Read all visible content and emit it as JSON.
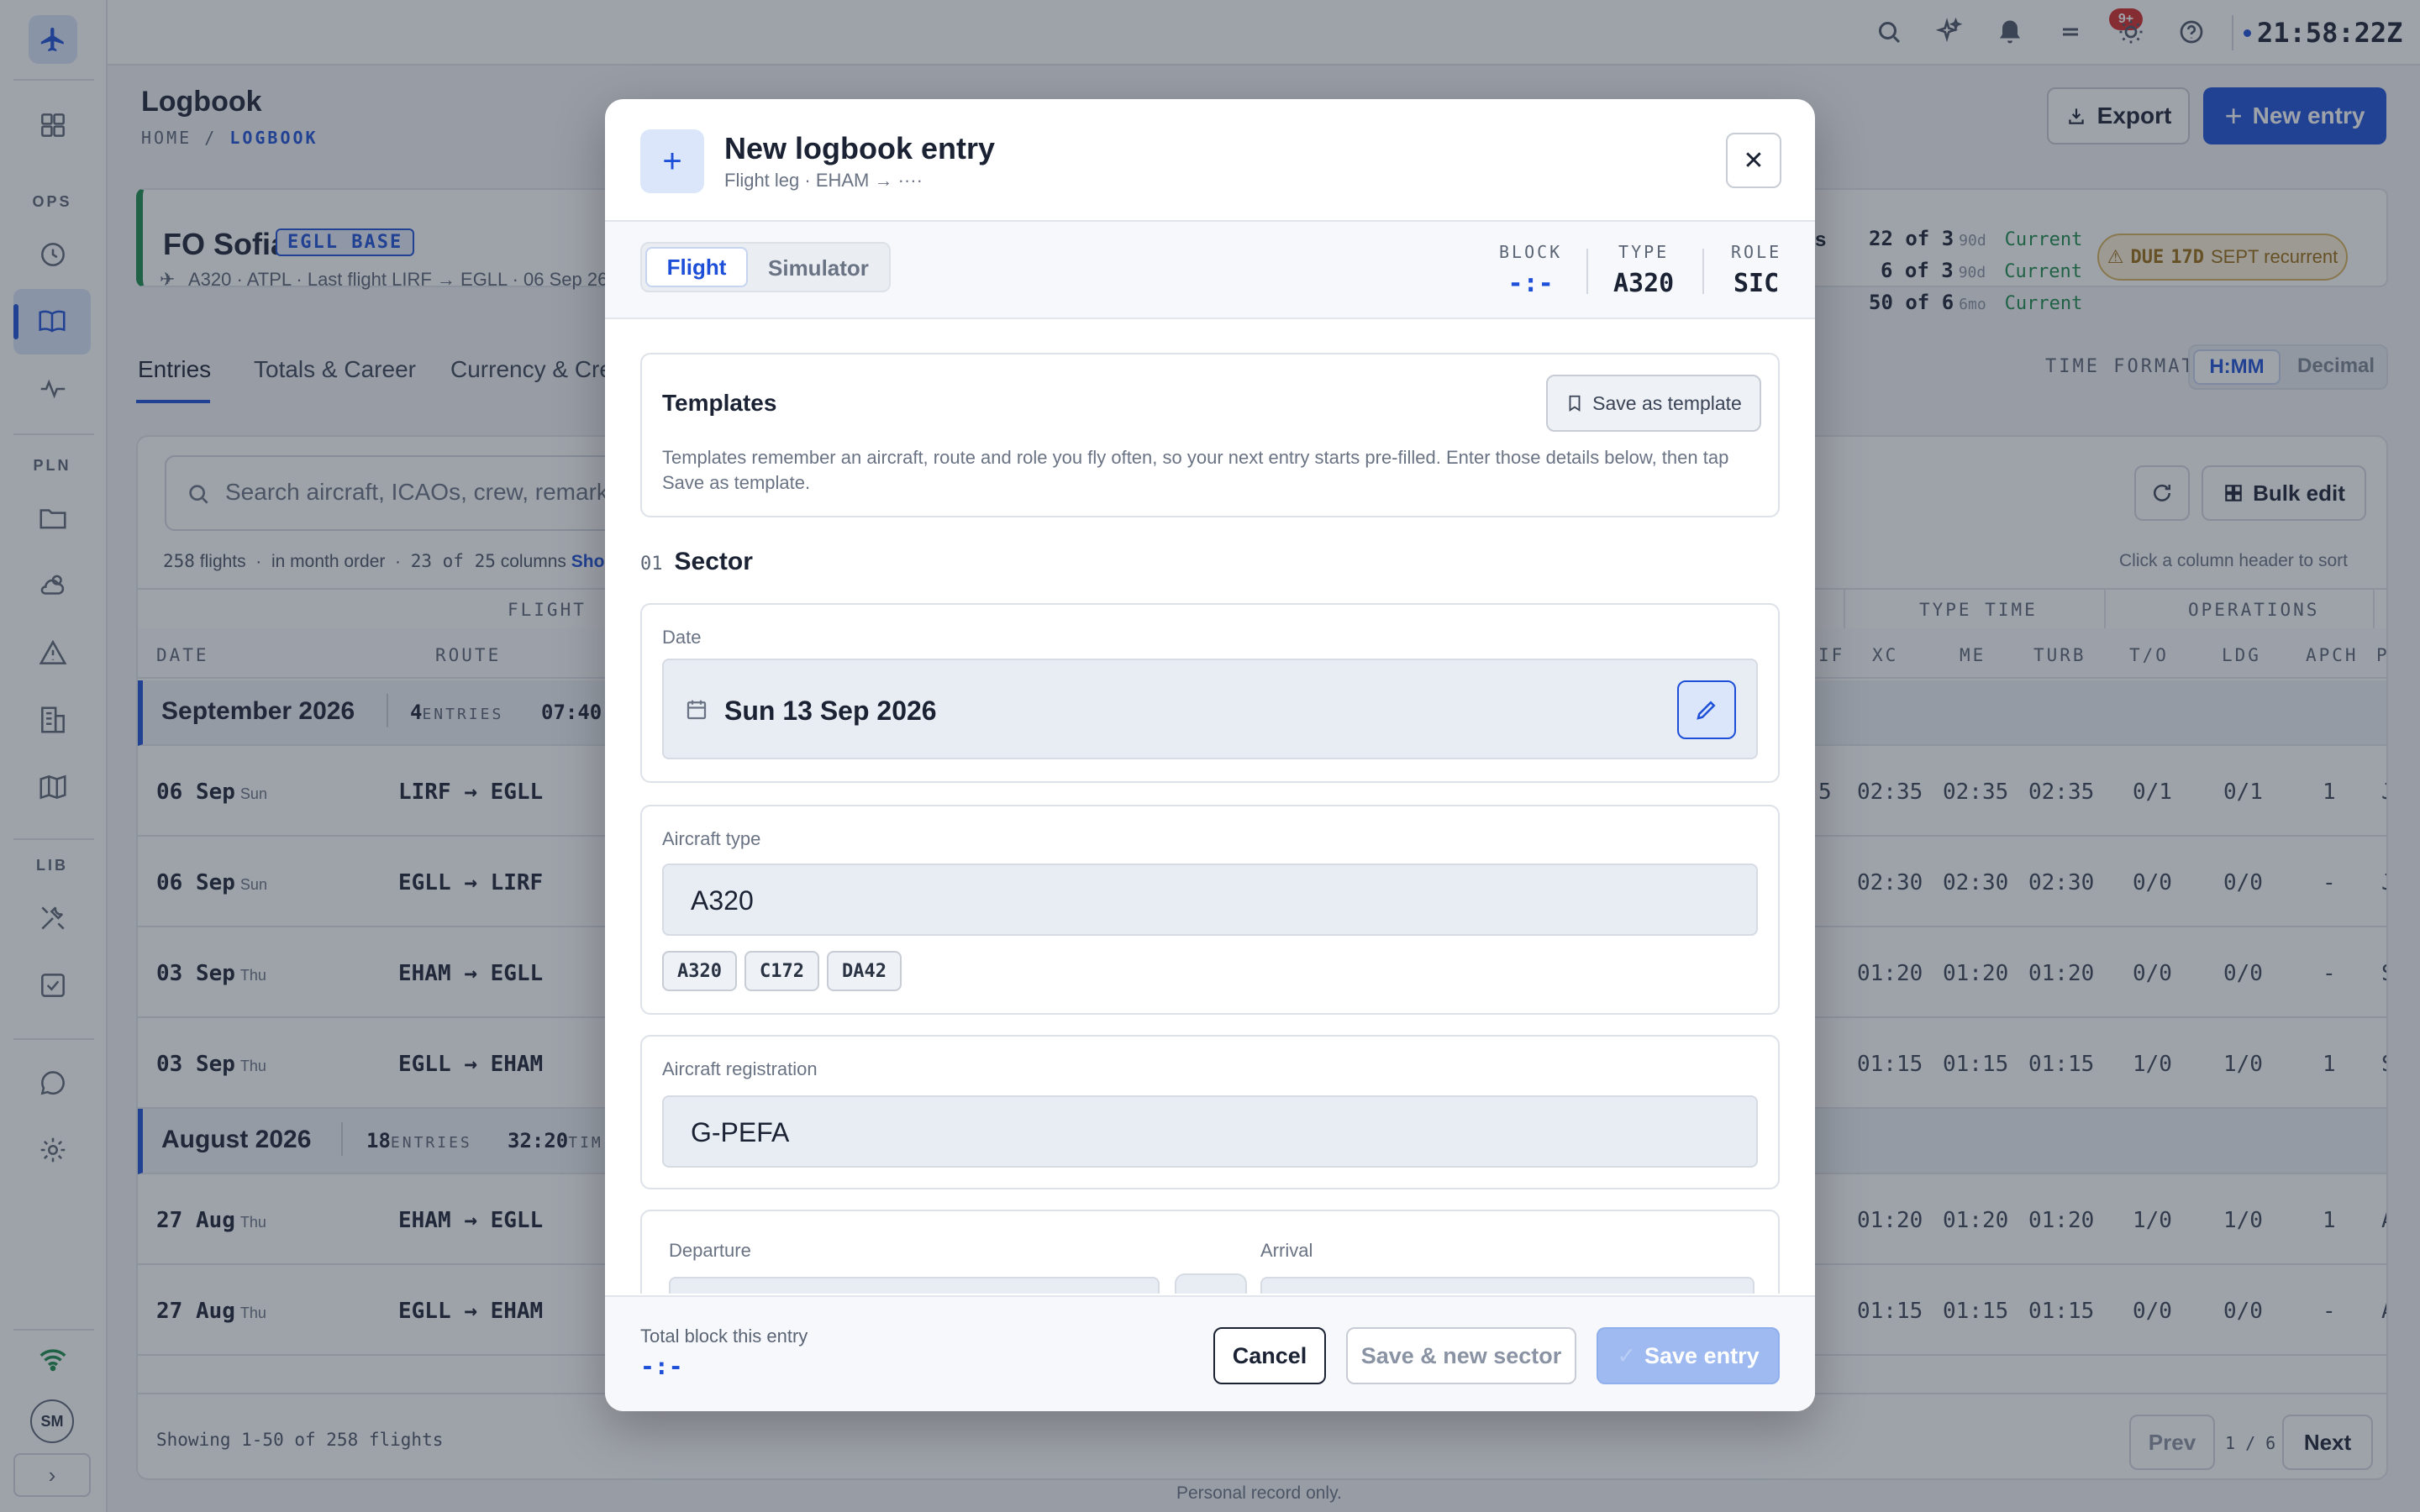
{
  "sidebar": {
    "sections": [
      "OPS",
      "PLN",
      "LIB"
    ],
    "avatar": "SM"
  },
  "topbar": {
    "notif_badge": "9+",
    "clock": "21:58:22Z"
  },
  "page": {
    "title": "Logbook",
    "crumb_home": "HOME",
    "crumb_sep": "/",
    "crumb_current": "LOGBOOK",
    "export_label": "Export",
    "new_entry_label": "New entry"
  },
  "pilot": {
    "name": "FO Sofia",
    "base": "EGLL BASE",
    "sub": "A320 · ATPL · Last flight LIRF → EGLL · 06 Sep 26",
    "currency": [
      {
        "value": "22 of 3",
        "period": "90d",
        "status": "Current"
      },
      {
        "value": "6 of 3",
        "period": "90d",
        "status": "Current"
      },
      {
        "value": "50 of 6",
        "period": "6mo",
        "status": "Current"
      }
    ],
    "currency_label_fragment": "s",
    "due_label": "DUE",
    "due_days": "17D",
    "due_text": "SEPT recurrent"
  },
  "tabs": [
    "Entries",
    "Totals & Career",
    "Currency & Cred"
  ],
  "time_format": {
    "label": "TIME FORMAT",
    "options": [
      "H:MM",
      "Decimal"
    ],
    "selected": "H:MM"
  },
  "table": {
    "search_placeholder": "Search aircraft, ICAOs, crew, remarks",
    "bulk_edit": "Bulk edit",
    "meta_flights": "258",
    "meta_flights_label": "flights",
    "meta_order": "in month order",
    "meta_columns": "23 of 25",
    "meta_columns_label": "columns",
    "meta_show": "Sho",
    "sort_hint": "Click a column header to sort",
    "group_headers": [
      "FLIGHT",
      "TYPE TIME",
      "OPERATIONS"
    ],
    "columns_left": [
      "DATE",
      "ROUTE"
    ],
    "columns_right": [
      "IF",
      "XC",
      "ME",
      "TURB",
      "T/O",
      "LDG",
      "APCH",
      "P"
    ],
    "months": [
      {
        "name": "September 2026",
        "count": "4",
        "count_label": "ENTRIES",
        "time": "07:40"
      },
      {
        "name": "August 2026",
        "count": "18",
        "count_label": "ENTRIES",
        "time": "32:20",
        "time_label": "TIM"
      }
    ],
    "rows": [
      {
        "date": "06 Sep",
        "dow": "Sun",
        "route": "LIRF → EGLL",
        "if": "5",
        "xc": "02:35",
        "me": "02:35",
        "turb": "02:35",
        "to": "0/1",
        "ldg": "0/1",
        "apch": "1",
        "p": "J"
      },
      {
        "date": "06 Sep",
        "dow": "Sun",
        "route": "EGLL → LIRF",
        "if": "",
        "xc": "02:30",
        "me": "02:30",
        "turb": "02:30",
        "to": "0/0",
        "ldg": "0/0",
        "apch": "-",
        "p": "J"
      },
      {
        "date": "03 Sep",
        "dow": "Thu",
        "route": "EHAM → EGLL",
        "if": "",
        "xc": "01:20",
        "me": "01:20",
        "turb": "01:20",
        "to": "0/0",
        "ldg": "0/0",
        "apch": "-",
        "p": "S"
      },
      {
        "date": "03 Sep",
        "dow": "Thu",
        "route": "EGLL → EHAM",
        "if": "",
        "xc": "01:15",
        "me": "01:15",
        "turb": "01:15",
        "to": "1/0",
        "ldg": "1/0",
        "apch": "1",
        "p": "S"
      },
      {
        "date": "27 Aug",
        "dow": "Thu",
        "route": "EHAM → EGLL",
        "if": "",
        "xc": "01:20",
        "me": "01:20",
        "turb": "01:20",
        "to": "1/0",
        "ldg": "1/0",
        "apch": "1",
        "p": "A"
      },
      {
        "date": "27 Aug",
        "dow": "Thu",
        "route": "EGLL → EHAM",
        "if": "",
        "xc": "01:15",
        "me": "01:15",
        "turb": "01:15",
        "to": "0/0",
        "ldg": "0/0",
        "apch": "-",
        "p": "A"
      }
    ],
    "showing": "Showing 1-50 of 258 flights",
    "prev": "Prev",
    "page_info": "1 / 6",
    "next": "Next",
    "personal_note": "Personal record only."
  },
  "modal": {
    "title": "New logbook entry",
    "subtitle": "Flight leg · EHAM → ····",
    "mode_options": [
      "Flight",
      "Simulator"
    ],
    "mode_selected": "Flight",
    "block_label": "BLOCK",
    "block_value": "-:-",
    "type_label": "TYPE",
    "type_value": "A320",
    "role_label": "ROLE",
    "role_value": "SIC",
    "templates_title": "Templates",
    "save_template": "Save as template",
    "templates_text": "Templates remember an aircraft, route and role you fly often, so your next entry starts pre-filled. Enter those details below, then tap Save as template.",
    "section_num": "01",
    "section_title": "Sector",
    "date_label": "Date",
    "date_value": "Sun 13 Sep 2026",
    "aircraft_type_label": "Aircraft type",
    "aircraft_type_value": "A320",
    "type_chips": [
      "A320",
      "C172",
      "DA42"
    ],
    "registration_label": "Aircraft registration",
    "registration_value": "G-PEFA",
    "departure_label": "Departure",
    "arrival_label": "Arrival",
    "total_label": "Total block this entry",
    "total_value": "-:-",
    "cancel": "Cancel",
    "save_new": "Save & new sector",
    "save_entry": "Save entry"
  }
}
